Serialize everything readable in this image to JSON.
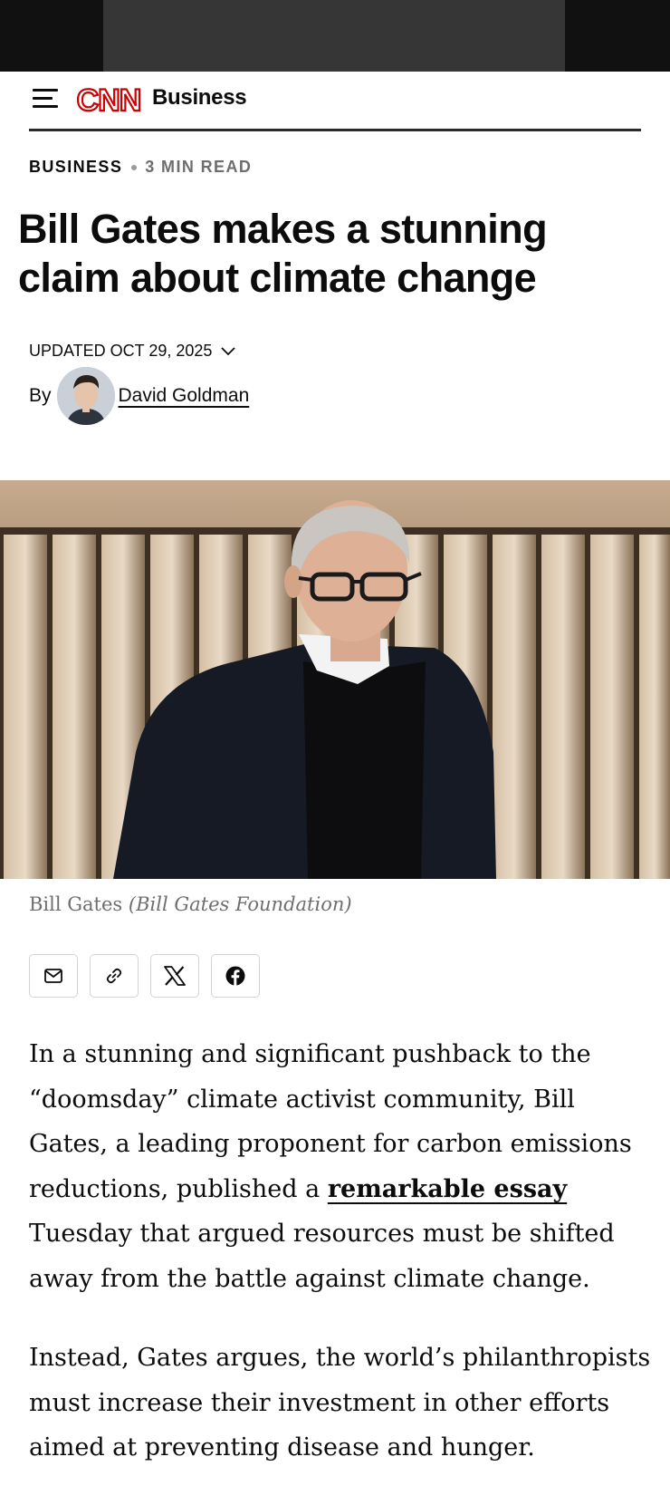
{
  "header": {
    "section_title": "Business",
    "logo": "CNN"
  },
  "article": {
    "kicker_section": "BUSINESS",
    "kicker_readtime": "3 MIN READ",
    "headline": "Bill Gates makes a stunning claim about climate change",
    "updated": "UPDATED OCT 29, 2025",
    "by": "By",
    "author": "David Goldman",
    "caption_name": "Bill Gates",
    "caption_credit": "(Bill Gates Foundation)",
    "paragraph1_before": "In a stunning and significant pushback to the “doomsday” climate activist community, Bill Gates, a leading proponent for carbon emissions reductions, published a ",
    "paragraph1_link": "remarkable essay",
    "paragraph1_after": " Tuesday that argued resources must be shifted away from the battle against climate change.",
    "paragraph2": "Instead, Gates argues, the world’s philanthropists must increase their investment in other efforts aimed at preventing disease and hunger."
  },
  "share": {
    "icons": [
      "email-icon",
      "link-icon",
      "x-icon",
      "facebook-icon"
    ]
  },
  "colors": {
    "brand_red": "#cc0000",
    "text": "#0c0c0c",
    "muted": "#6e6e6e"
  }
}
